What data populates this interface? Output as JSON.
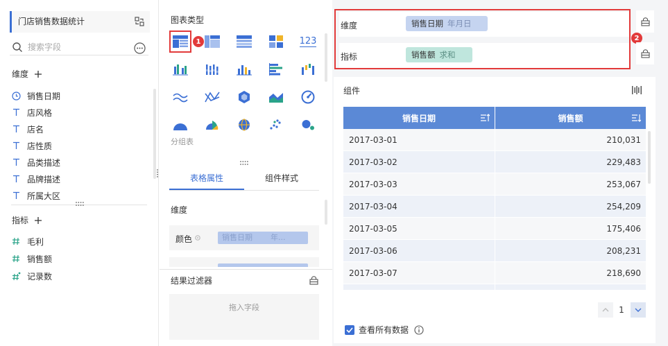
{
  "left": {
    "dataset_title": "门店销售数据统计",
    "search_placeholder": "搜索字段",
    "dimension_header": "维度",
    "dimensions": [
      {
        "icon": "clock-icon",
        "label": "销售日期"
      },
      {
        "icon": "text-type-icon",
        "label": "店风格"
      },
      {
        "icon": "text-type-icon",
        "label": "店名"
      },
      {
        "icon": "text-type-icon",
        "label": "店性质"
      },
      {
        "icon": "text-type-icon",
        "label": "品类描述"
      },
      {
        "icon": "text-type-icon",
        "label": "品牌描述"
      },
      {
        "icon": "text-type-icon",
        "label": "所属大区"
      }
    ],
    "metric_header": "指标",
    "metrics": [
      {
        "icon": "hash-icon",
        "label": "毛利"
      },
      {
        "icon": "hash-icon",
        "label": "销售额"
      },
      {
        "icon": "hash-star-icon",
        "label": "记录数"
      }
    ]
  },
  "middle": {
    "chart_type_title": "图表类型",
    "badge_1": "1",
    "chart_type_123_label": "123",
    "group_table_label": "分组表",
    "tabs": [
      "表格属性",
      "组件样式"
    ],
    "prop_dimension_label": "维度",
    "color_label": "颜色",
    "color_pill": {
      "field": "销售日期",
      "gran": "年..."
    },
    "filter_title": "结果过滤器",
    "filter_drop_placeholder": "拖入字段"
  },
  "right": {
    "badge_2": "2",
    "dimension_shelf": {
      "label": "维度",
      "field": "销售日期",
      "agg": "年月日"
    },
    "metric_shelf": {
      "label": "指标",
      "field": "销售额",
      "agg": "求和"
    },
    "component_title": "组件",
    "table": {
      "columns": [
        "销售日期",
        "销售额"
      ],
      "rows": [
        [
          "2017-03-01",
          "210,031"
        ],
        [
          "2017-03-02",
          "229,483"
        ],
        [
          "2017-03-03",
          "253,067"
        ],
        [
          "2017-03-04",
          "254,209"
        ],
        [
          "2017-03-05",
          "175,406"
        ],
        [
          "2017-03-06",
          "208,231"
        ],
        [
          "2017-03-07",
          "218,690"
        ],
        [
          "",
          ""
        ]
      ]
    },
    "pager_page": "1",
    "view_all_label": "查看所有数据"
  },
  "colors": {
    "accent": "#3b6fd4",
    "highlight": "#e23a3a",
    "header_bg": "#5b89d6",
    "dimension_pill": "#c5d4f0",
    "metric_pill": "#bfe6dd"
  }
}
